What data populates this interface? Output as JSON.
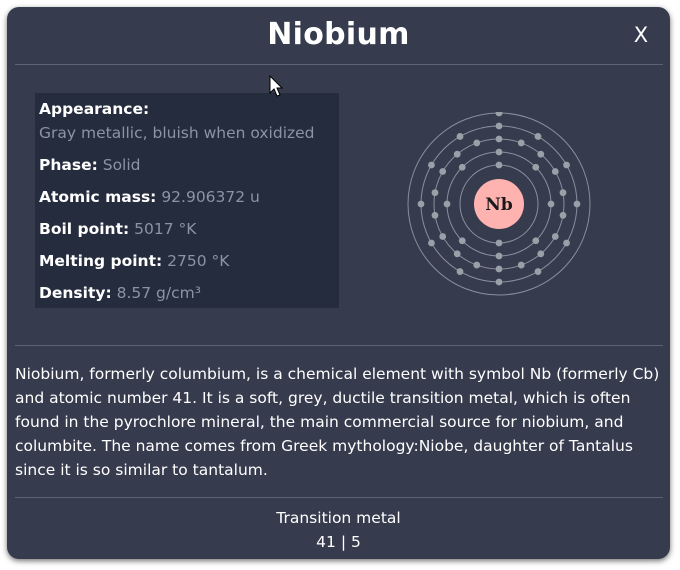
{
  "dialog": {
    "title": "Niobium",
    "close_label": "X"
  },
  "properties": {
    "appearance_label": "Appearance:",
    "appearance_value": "Gray metallic, bluish when oxidized",
    "phase_label": "Phase:",
    "phase_value": "Solid",
    "atomic_mass_label": "Atomic mass:",
    "atomic_mass_value": "92.906372 u",
    "boil_point_label": "Boil point:",
    "boil_point_value": "5017 °K",
    "melting_point_label": "Melting point:",
    "melting_point_value": "2750 °K",
    "density_label": "Density:",
    "density_value": "8.57 g/cm³"
  },
  "atom": {
    "symbol": "Nb",
    "shells": [
      2,
      8,
      18,
      12,
      1
    ],
    "nucleus_color": "#ffb3b0",
    "shell_color": "#8a8f9e",
    "electron_color": "#9aa0a8"
  },
  "description": "Niobium, formerly columbium, is a chemical element with symbol Nb (formerly Cb) and atomic number 41. It is a soft, grey, ductile transition metal, which is often found in the pyrochlore mineral, the main commercial source for niobium, and columbite. The name comes from Greek mythology:Niobe, daughter of Tantalus since it is so similar to tantalum.",
  "footer": {
    "category": "Transition metal",
    "atomic_number": "41",
    "separator": "|",
    "period": "5"
  }
}
